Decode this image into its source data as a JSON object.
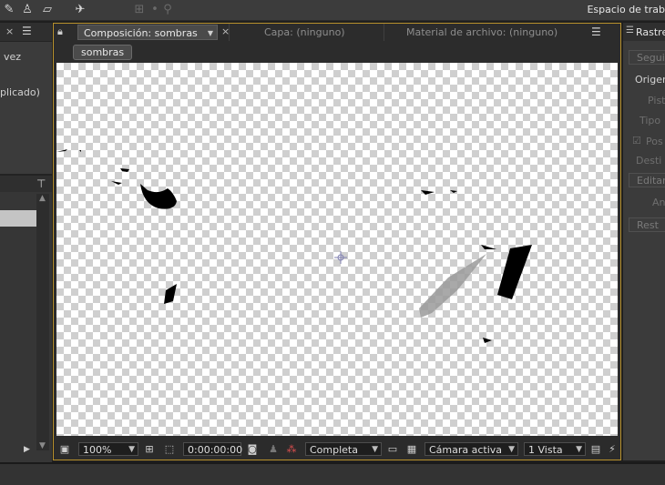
{
  "toolbar": {
    "workspace_label": "Espacio de trab",
    "icons": [
      "pen-icon",
      "puppet-icon",
      "eraser-icon",
      "pin-icon",
      "axis-icon",
      "dot-icon",
      "pin-small-icon"
    ]
  },
  "left_panel": {
    "line1": "vez",
    "line2": "plicado)"
  },
  "composition": {
    "tab_comp_label": "Composición: sombras",
    "tab_layer_label": "Capa: (ninguno)",
    "tab_footage_label": "Material de archivo: (ninguno)",
    "breadcrumb": "sombras"
  },
  "viewer_bar": {
    "zoom": "100%",
    "timecode": "0:00:00:00",
    "resolution": "Completa",
    "camera": "Cámara activa",
    "views": "1 Vista"
  },
  "right_panel": {
    "tab_label": "Rastrea",
    "btn1": "Segui",
    "origin_label": "Origen",
    "pista_label": "Pist",
    "tipo_label": "Tipo",
    "pos_label": "Pos",
    "destino_label": "Desti",
    "editar_label": "Editar",
    "an_label": "An",
    "restablecer_label": "Rest"
  },
  "colors": {
    "accent": "#b8912c",
    "panel": "#3b3b3b",
    "checker": "#cfcfcf"
  }
}
